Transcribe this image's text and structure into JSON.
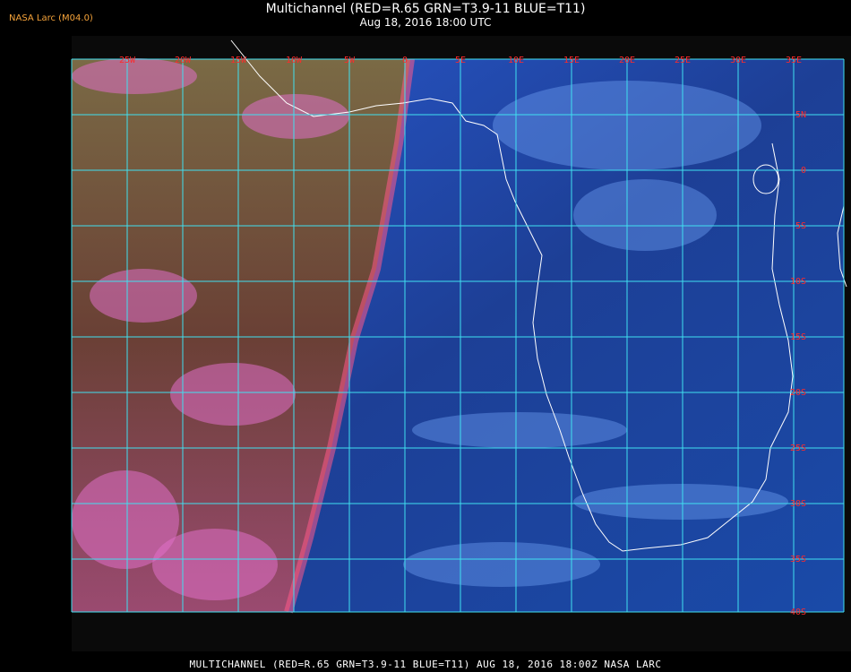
{
  "header": {
    "title": "Multichannel (RED=R.65 GRN=T3.9-11 BLUE=T11)",
    "datetime": "Aug 18, 2016 18:00 UTC",
    "brand": "NASA Larc (M04.0)"
  },
  "footer": {
    "text": "MULTICHANNEL  (RED=R.65 GRN=T3.9-11 BLUE=T11) AUG 18, 2016 18:00Z   NASA LARC"
  },
  "map": {
    "longitude_labels": [
      "25W",
      "20W",
      "15W",
      "10W",
      "5W",
      "0",
      "5E",
      "10E",
      "15E",
      "20E",
      "25E",
      "30E",
      "35E"
    ],
    "latitude_labels": [
      "5N",
      "0",
      "5S",
      "10S",
      "15S",
      "20S",
      "25S",
      "30S",
      "35S",
      "40S"
    ],
    "colors": {
      "grid": "#40e0f0",
      "labels": "#ff2a2a",
      "coastline": "#ffffff",
      "day_side": "#7a5040",
      "night_side": "#1a3a88"
    }
  }
}
